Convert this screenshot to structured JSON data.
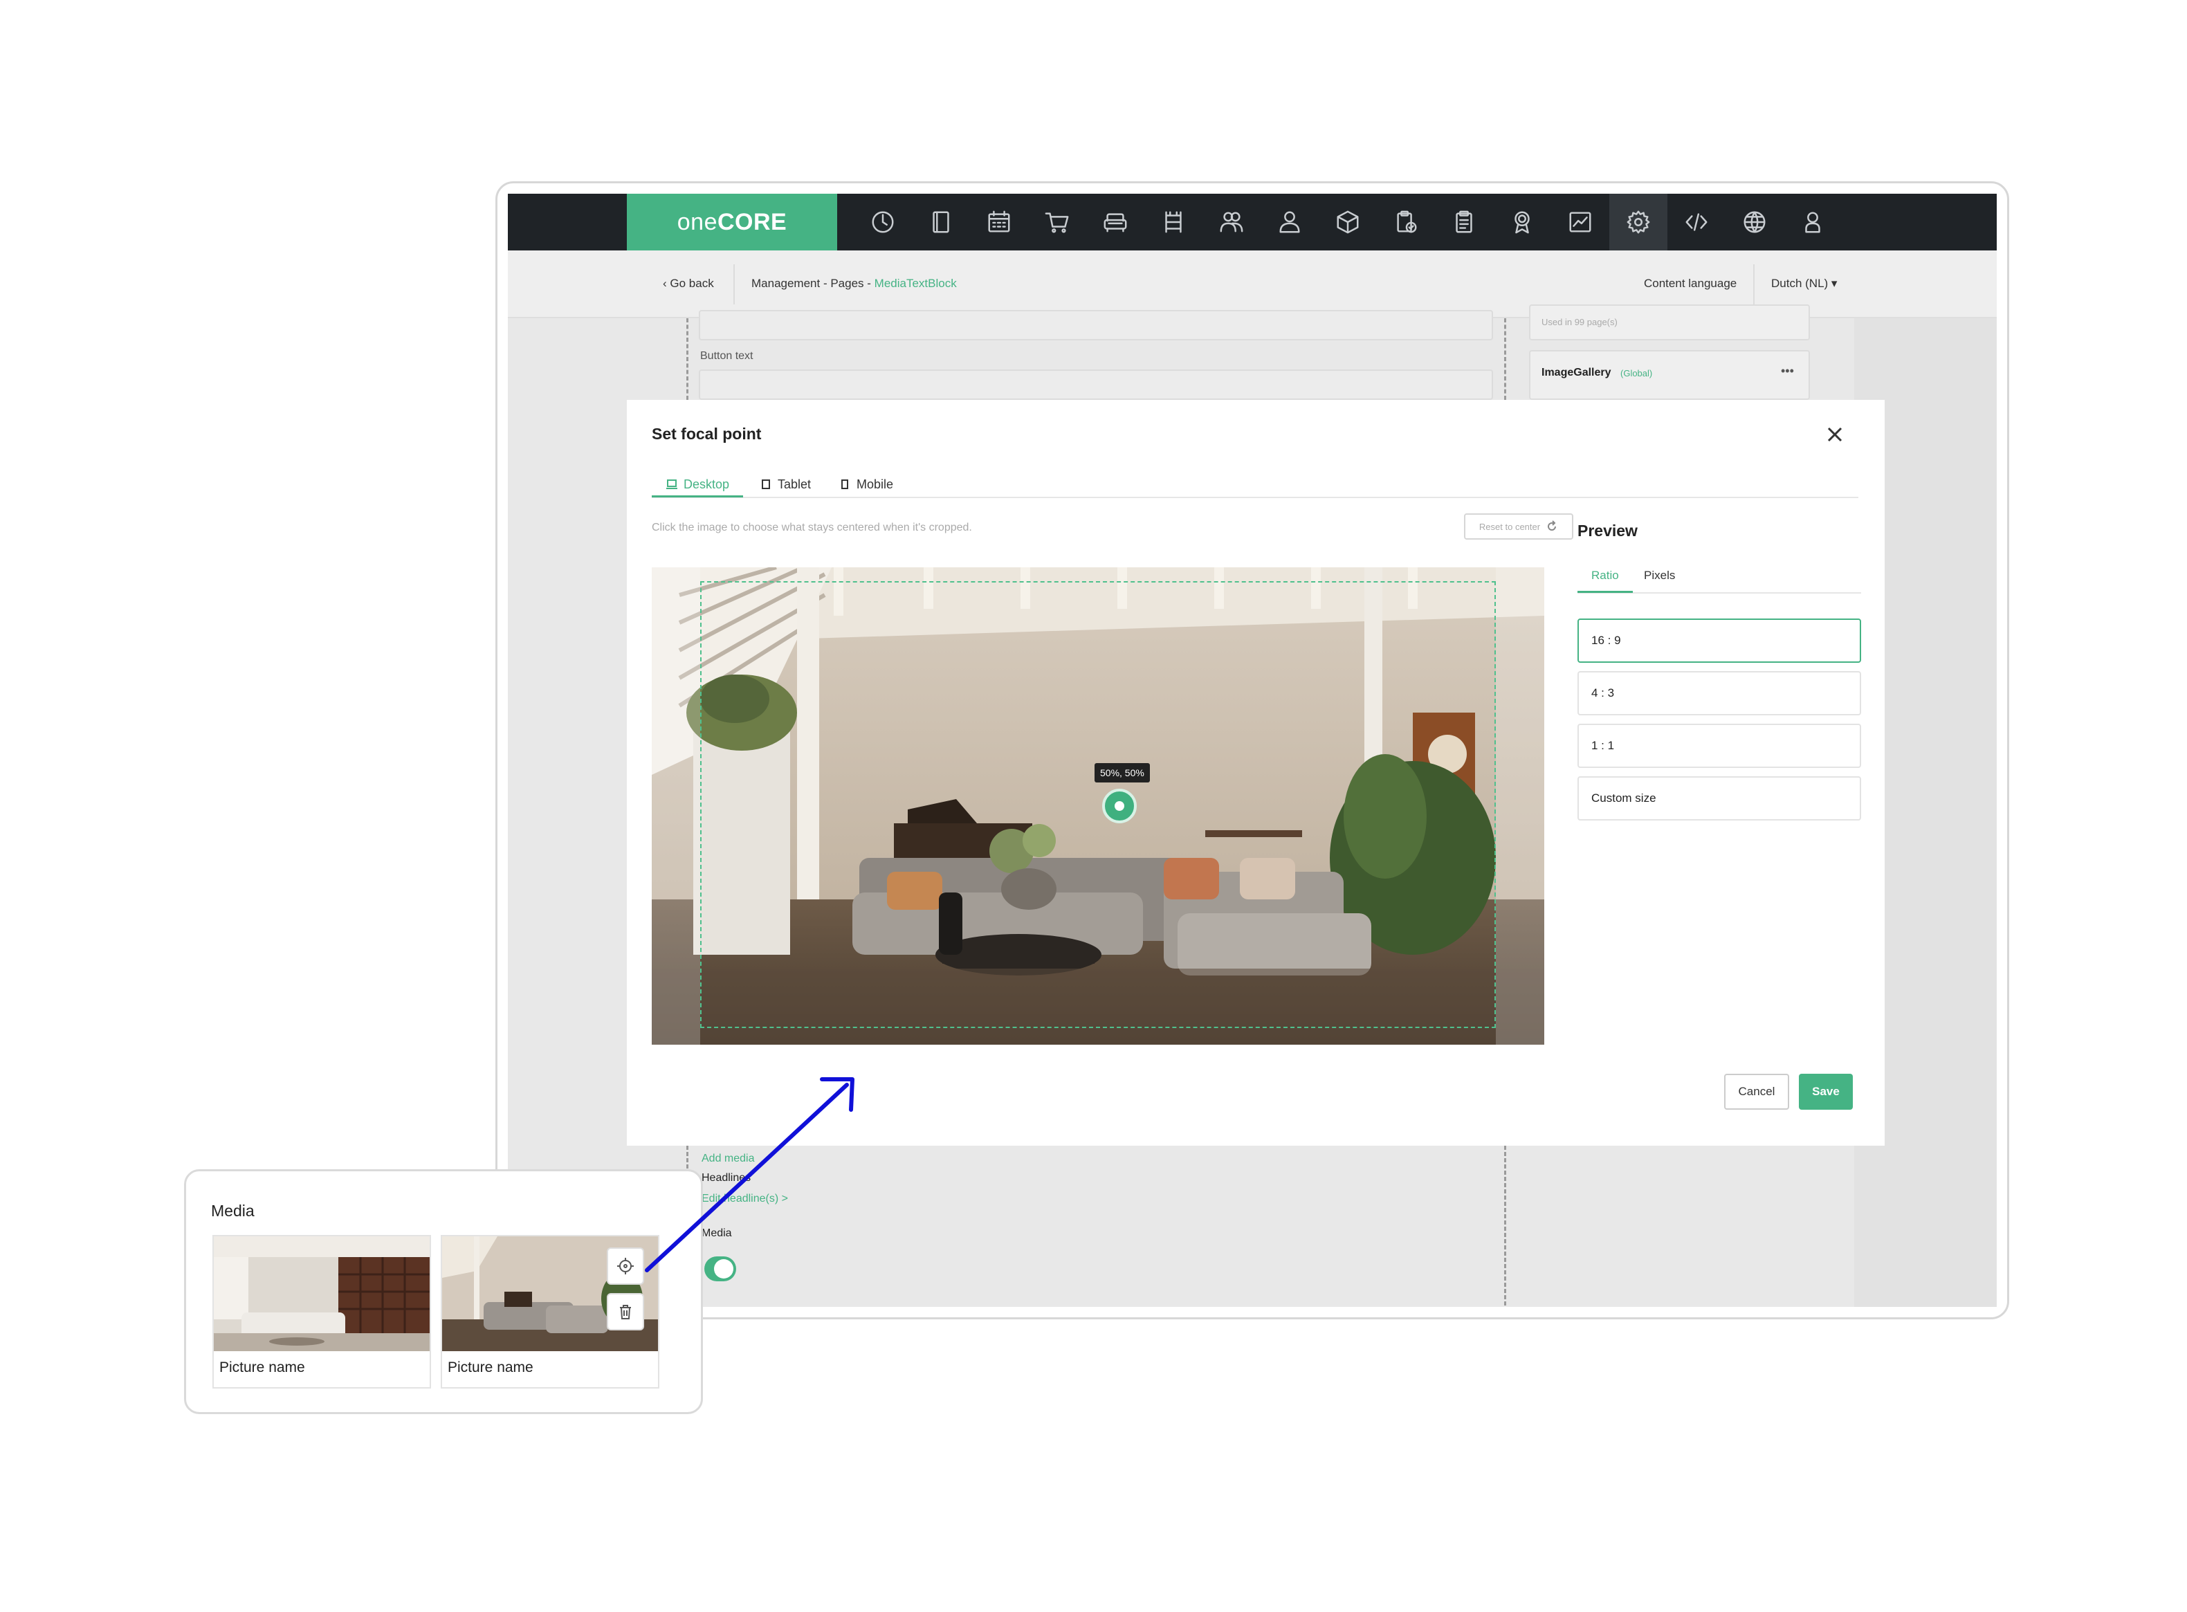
{
  "app": {
    "logo_light": "one",
    "logo_bold": "CORE"
  },
  "nav_icons": [
    "dashboard-icon",
    "book-icon",
    "calendar-icon",
    "cart-icon",
    "sofa-icon",
    "shelf-icon",
    "users-icon",
    "user-icon",
    "box-3d-icon",
    "clipboard-check-icon",
    "clipboard-icon",
    "award-icon",
    "chart-icon",
    "settings-icon",
    "code-icon",
    "globe-icon",
    "account-icon"
  ],
  "subbar": {
    "go_back": "‹ Go back",
    "crumbs_prefix": "Management - Pages - ",
    "crumbs_current": "MediaTextBlock",
    "language_label": "Content language",
    "language_value": "Dutch (NL) ▾"
  },
  "page_bg": {
    "button_text_label": "Button text",
    "used_in": "Used in 99 page(s)",
    "gallery_name": "ImageGallery",
    "gallery_scope": "(Global)",
    "gallery_menu": "•••",
    "add_media": "Add media",
    "headlines": "Headlines",
    "edit_headlines": "Edit headline(s) >",
    "media_label": "Media"
  },
  "modal": {
    "title": "Set focal point",
    "tabs": [
      "Desktop",
      "Tablet",
      "Mobile"
    ],
    "hint": "Click the image to choose what stays centered when it's cropped.",
    "reset_label": "Reset to center",
    "focal_value": "50%, 50%",
    "preview_title": "Preview",
    "preview_tabs": [
      "Ratio",
      "Pixels"
    ],
    "ratios": [
      "16 : 9",
      "4 : 3",
      "1 : 1",
      "Custom size"
    ],
    "selected_ratio": "16 : 9",
    "cancel": "Cancel",
    "save": "Save"
  },
  "media_card": {
    "title": "Media",
    "items": [
      {
        "name": "Picture name"
      },
      {
        "name": "Picture name"
      }
    ]
  },
  "colors": {
    "accent": "#45b384",
    "nav_bg": "#1f2327",
    "arrow": "#1010d8"
  }
}
